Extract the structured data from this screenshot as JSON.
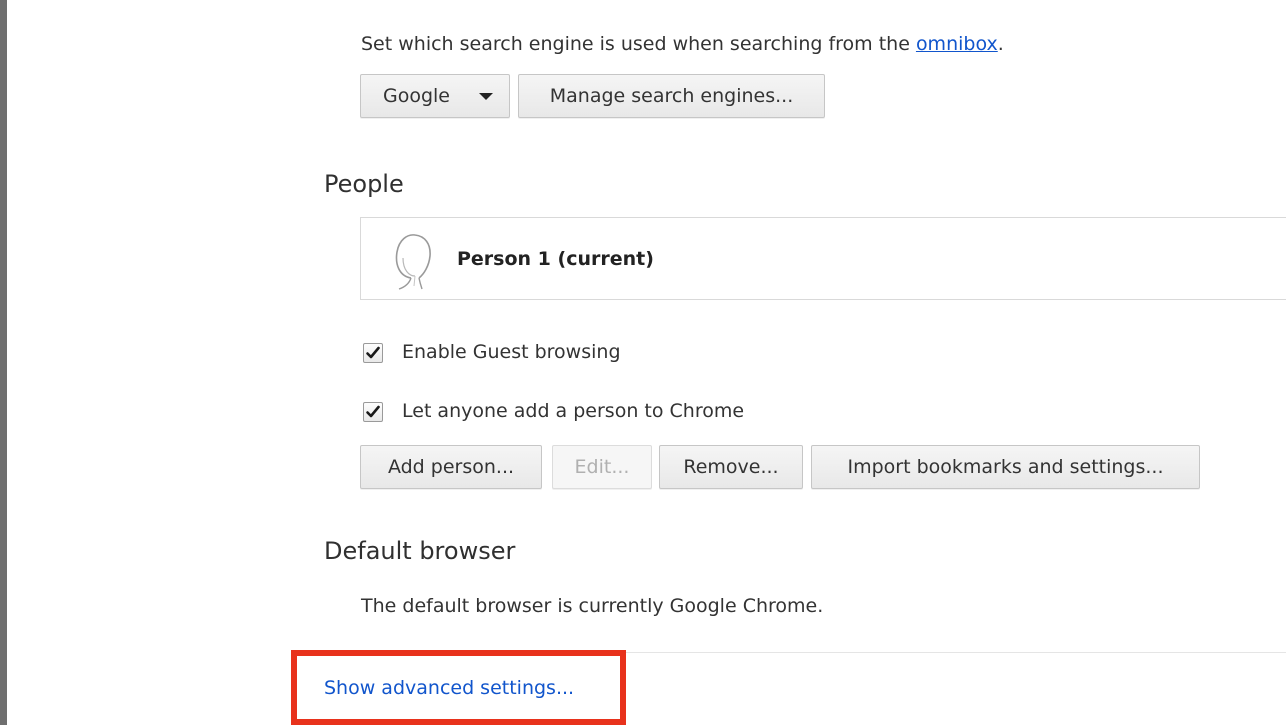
{
  "search": {
    "description_prefix": "Set which search engine is used when searching from the ",
    "description_link": "omnibox",
    "description_suffix": ".",
    "engine_selected": "Google",
    "manage_button": "Manage search engines..."
  },
  "people": {
    "title": "People",
    "current_person": "Person 1 (current)",
    "guest_browsing_label": "Enable Guest browsing",
    "guest_browsing_checked": true,
    "anyone_add_label": "Let anyone add a person to Chrome",
    "anyone_add_checked": true,
    "buttons": {
      "add": "Add person...",
      "edit": "Edit...",
      "remove": "Remove...",
      "import": "Import bookmarks and settings..."
    }
  },
  "default_browser": {
    "title": "Default browser",
    "status": "The default browser is currently Google Chrome."
  },
  "advanced": {
    "link_label": "Show advanced settings..."
  },
  "colors": {
    "link": "#1155cc",
    "highlight": "#e8321c"
  }
}
